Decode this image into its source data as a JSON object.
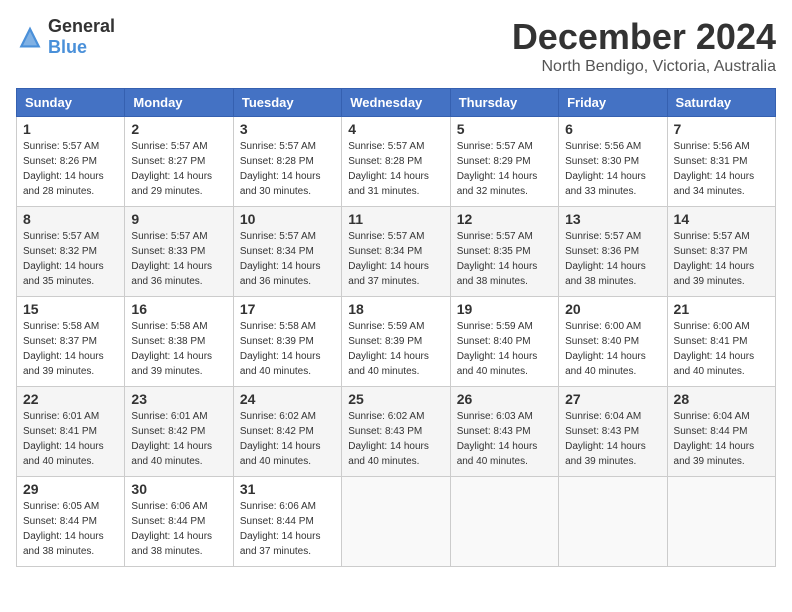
{
  "header": {
    "logo": {
      "general": "General",
      "blue": "Blue"
    },
    "month": "December 2024",
    "location": "North Bendigo, Victoria, Australia"
  },
  "weekdays": [
    "Sunday",
    "Monday",
    "Tuesday",
    "Wednesday",
    "Thursday",
    "Friday",
    "Saturday"
  ],
  "weeks": [
    [
      {
        "day": "1",
        "sunrise": "5:57 AM",
        "sunset": "8:26 PM",
        "daylight": "14 hours and 28 minutes."
      },
      {
        "day": "2",
        "sunrise": "5:57 AM",
        "sunset": "8:27 PM",
        "daylight": "14 hours and 29 minutes."
      },
      {
        "day": "3",
        "sunrise": "5:57 AM",
        "sunset": "8:28 PM",
        "daylight": "14 hours and 30 minutes."
      },
      {
        "day": "4",
        "sunrise": "5:57 AM",
        "sunset": "8:28 PM",
        "daylight": "14 hours and 31 minutes."
      },
      {
        "day": "5",
        "sunrise": "5:57 AM",
        "sunset": "8:29 PM",
        "daylight": "14 hours and 32 minutes."
      },
      {
        "day": "6",
        "sunrise": "5:56 AM",
        "sunset": "8:30 PM",
        "daylight": "14 hours and 33 minutes."
      },
      {
        "day": "7",
        "sunrise": "5:56 AM",
        "sunset": "8:31 PM",
        "daylight": "14 hours and 34 minutes."
      }
    ],
    [
      {
        "day": "8",
        "sunrise": "5:57 AM",
        "sunset": "8:32 PM",
        "daylight": "14 hours and 35 minutes."
      },
      {
        "day": "9",
        "sunrise": "5:57 AM",
        "sunset": "8:33 PM",
        "daylight": "14 hours and 36 minutes."
      },
      {
        "day": "10",
        "sunrise": "5:57 AM",
        "sunset": "8:34 PM",
        "daylight": "14 hours and 36 minutes."
      },
      {
        "day": "11",
        "sunrise": "5:57 AM",
        "sunset": "8:34 PM",
        "daylight": "14 hours and 37 minutes."
      },
      {
        "day": "12",
        "sunrise": "5:57 AM",
        "sunset": "8:35 PM",
        "daylight": "14 hours and 38 minutes."
      },
      {
        "day": "13",
        "sunrise": "5:57 AM",
        "sunset": "8:36 PM",
        "daylight": "14 hours and 38 minutes."
      },
      {
        "day": "14",
        "sunrise": "5:57 AM",
        "sunset": "8:37 PM",
        "daylight": "14 hours and 39 minutes."
      }
    ],
    [
      {
        "day": "15",
        "sunrise": "5:58 AM",
        "sunset": "8:37 PM",
        "daylight": "14 hours and 39 minutes."
      },
      {
        "day": "16",
        "sunrise": "5:58 AM",
        "sunset": "8:38 PM",
        "daylight": "14 hours and 39 minutes."
      },
      {
        "day": "17",
        "sunrise": "5:58 AM",
        "sunset": "8:39 PM",
        "daylight": "14 hours and 40 minutes."
      },
      {
        "day": "18",
        "sunrise": "5:59 AM",
        "sunset": "8:39 PM",
        "daylight": "14 hours and 40 minutes."
      },
      {
        "day": "19",
        "sunrise": "5:59 AM",
        "sunset": "8:40 PM",
        "daylight": "14 hours and 40 minutes."
      },
      {
        "day": "20",
        "sunrise": "6:00 AM",
        "sunset": "8:40 PM",
        "daylight": "14 hours and 40 minutes."
      },
      {
        "day": "21",
        "sunrise": "6:00 AM",
        "sunset": "8:41 PM",
        "daylight": "14 hours and 40 minutes."
      }
    ],
    [
      {
        "day": "22",
        "sunrise": "6:01 AM",
        "sunset": "8:41 PM",
        "daylight": "14 hours and 40 minutes."
      },
      {
        "day": "23",
        "sunrise": "6:01 AM",
        "sunset": "8:42 PM",
        "daylight": "14 hours and 40 minutes."
      },
      {
        "day": "24",
        "sunrise": "6:02 AM",
        "sunset": "8:42 PM",
        "daylight": "14 hours and 40 minutes."
      },
      {
        "day": "25",
        "sunrise": "6:02 AM",
        "sunset": "8:43 PM",
        "daylight": "14 hours and 40 minutes."
      },
      {
        "day": "26",
        "sunrise": "6:03 AM",
        "sunset": "8:43 PM",
        "daylight": "14 hours and 40 minutes."
      },
      {
        "day": "27",
        "sunrise": "6:04 AM",
        "sunset": "8:43 PM",
        "daylight": "14 hours and 39 minutes."
      },
      {
        "day": "28",
        "sunrise": "6:04 AM",
        "sunset": "8:44 PM",
        "daylight": "14 hours and 39 minutes."
      }
    ],
    [
      {
        "day": "29",
        "sunrise": "6:05 AM",
        "sunset": "8:44 PM",
        "daylight": "14 hours and 38 minutes."
      },
      {
        "day": "30",
        "sunrise": "6:06 AM",
        "sunset": "8:44 PM",
        "daylight": "14 hours and 38 minutes."
      },
      {
        "day": "31",
        "sunrise": "6:06 AM",
        "sunset": "8:44 PM",
        "daylight": "14 hours and 37 minutes."
      },
      null,
      null,
      null,
      null
    ]
  ],
  "labels": {
    "sunrise": "Sunrise:",
    "sunset": "Sunset:",
    "daylight": "Daylight:"
  }
}
